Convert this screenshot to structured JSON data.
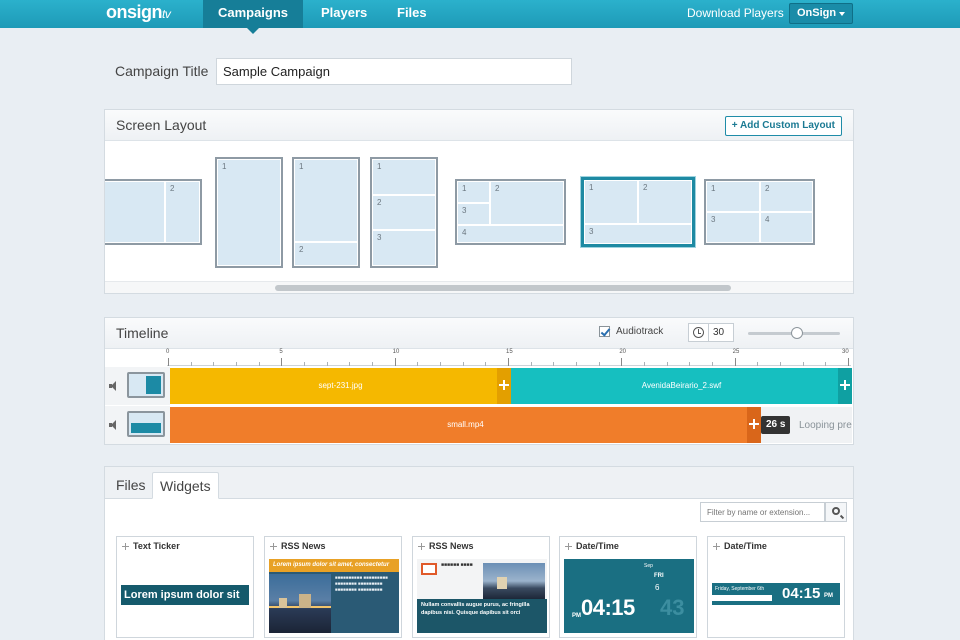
{
  "nav": {
    "logo_main": "onsign",
    "logo_suffix": "tv",
    "items": [
      "Campaigns",
      "Players",
      "Files"
    ],
    "download": "Download Players",
    "org": "OnSign",
    "accent": "#1e9ab7"
  },
  "campaign": {
    "label": "Campaign Title",
    "value": "Sample Campaign"
  },
  "screen_layout": {
    "title": "Screen Layout",
    "add_button": "+ Add Custom Layout",
    "selected_index": 5
  },
  "timeline": {
    "title": "Timeline",
    "audiotrack_label": "Audiotrack",
    "audiotrack_checked": true,
    "duration": "30",
    "ticks": [
      "0",
      "5",
      "10",
      "15",
      "20",
      "25",
      "30"
    ],
    "tracks": [
      {
        "blocks": [
          {
            "label": "sept-231.jpg",
            "color": "#f5b800"
          },
          {
            "label": "AvenidaBeirario_2.swf",
            "color": "#16bfc0"
          }
        ]
      },
      {
        "blocks": [
          {
            "label": "small.mp4",
            "color": "#f07d2a"
          }
        ],
        "badge": "26 s",
        "looping": "Looping pre"
      }
    ]
  },
  "widgets_panel": {
    "tabs": [
      "Files",
      "Widgets"
    ],
    "active_tab": "Widgets",
    "filter_placeholder": "Filter by name or extension...",
    "cards": [
      {
        "title": "Text Ticker",
        "preview_text": "Lorem ipsum dolor sit"
      },
      {
        "title": "RSS News",
        "preview_text": "Lorem ipsum dolor sit amet, consectetur"
      },
      {
        "title": "RSS News",
        "preview_text": "Nullam convallis augue purus, ac fringilla dapibus nisi. Quisque dapibus sit orci"
      },
      {
        "title": "Date/Time",
        "preview_text": "04:15",
        "month": "Sep",
        "day": "FRI",
        "date": "6",
        "ampm": "PM"
      },
      {
        "title": "Date/Time",
        "preview_text": "04:15",
        "ampm": "PM",
        "date_line": "Friday, September 6th"
      }
    ]
  }
}
